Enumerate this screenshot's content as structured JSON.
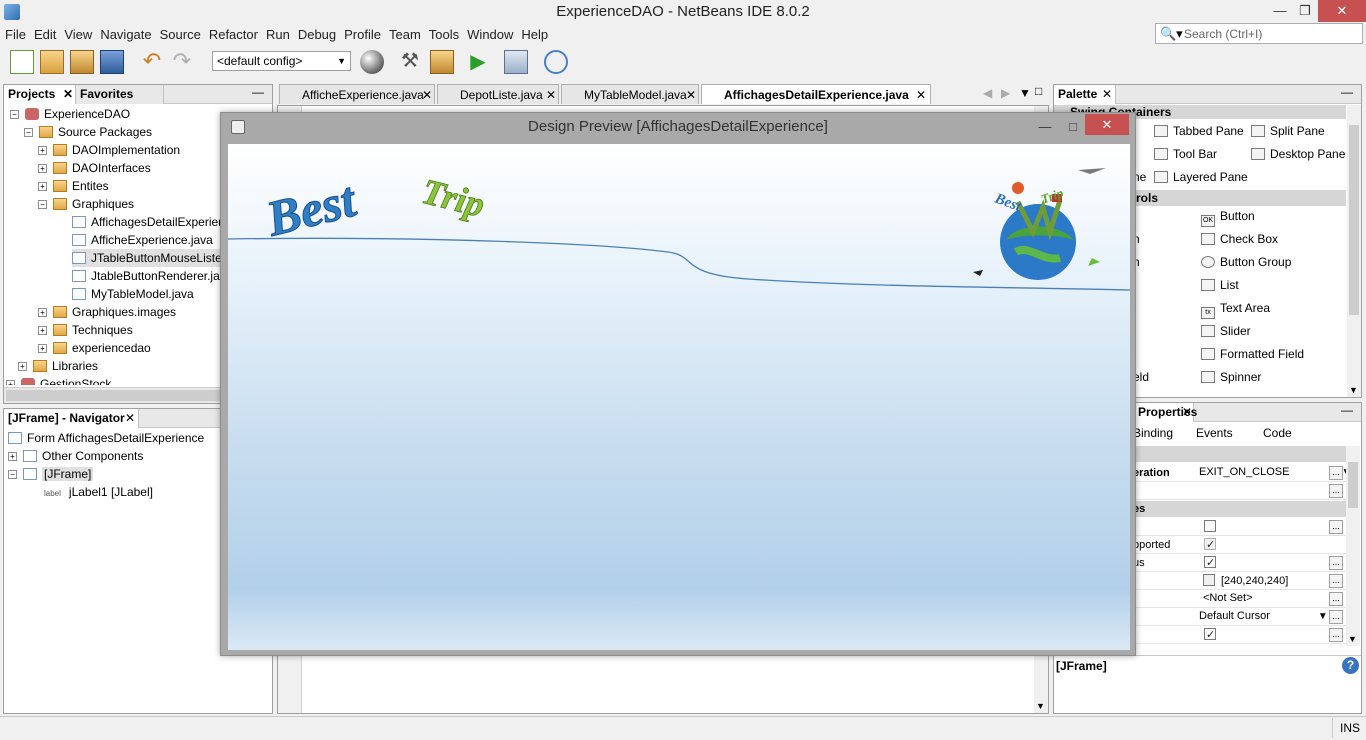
{
  "window": {
    "title": "ExperienceDAO - NetBeans IDE 8.0.2"
  },
  "menu": [
    "File",
    "Edit",
    "View",
    "Navigate",
    "Source",
    "Refactor",
    "Run",
    "Debug",
    "Profile",
    "Team",
    "Tools",
    "Window",
    "Help"
  ],
  "search": {
    "placeholder": "Search (Ctrl+I)"
  },
  "toolbar": {
    "config": "<default config>"
  },
  "projects_panel": {
    "tabs": [
      "Projects",
      "Favorites"
    ],
    "tree": [
      {
        "label": "ExperienceDAO",
        "icon": "project-icon"
      },
      {
        "label": "Source Packages",
        "icon": "folder-icon"
      },
      {
        "label": "DAOImplementation",
        "icon": "package-icon"
      },
      {
        "label": "DAOInterfaces",
        "icon": "package-icon"
      },
      {
        "label": "Entites",
        "icon": "package-icon"
      },
      {
        "label": "Graphiques",
        "icon": "package-icon"
      },
      {
        "label": "AffichagesDetailExperien",
        "icon": "java-file-icon"
      },
      {
        "label": "AfficheExperience.java",
        "icon": "java-file-icon"
      },
      {
        "label": "JTableButtonMouseListene",
        "icon": "java-file-icon"
      },
      {
        "label": "JtableButtonRenderer.jav",
        "icon": "java-file-icon"
      },
      {
        "label": "MyTableModel.java",
        "icon": "java-file-icon"
      },
      {
        "label": "Graphiques.images",
        "icon": "package-icon"
      },
      {
        "label": "Techniques",
        "icon": "package-icon"
      },
      {
        "label": "experiencedao",
        "icon": "package-icon"
      },
      {
        "label": "Libraries",
        "icon": "library-icon"
      },
      {
        "label": "GestionStock",
        "icon": "project-icon"
      }
    ]
  },
  "navigator": {
    "tab": "[JFrame] - Navigator",
    "items": [
      "Form AffichagesDetailExperience",
      "Other Components",
      "[JFrame]",
      "jLabel1 [JLabel]"
    ],
    "label_icon_text": "label"
  },
  "editor_tabs": [
    "AfficheExperience.java",
    "DepotListe.java",
    "MyTableModel.java",
    "AffichagesDetailExperience.java"
  ],
  "preview": {
    "title": "Design Preview [AffichagesDetailExperience]",
    "logo_word1": "Best",
    "logo_word2": "Trip"
  },
  "palette": {
    "tab": "Palette",
    "section1": "Swing Containers",
    "section2": "Swing Controls",
    "containers": [
      "Tabbed Pane",
      "Split Pane",
      "Tool Bar",
      "Desktop Pane",
      "Layered Pane"
    ],
    "left_fragments": [
      "ne",
      "n",
      "n",
      "eld"
    ],
    "controls": [
      "Button",
      "Check Box",
      "Button Group",
      "List",
      "Text Area",
      "Slider",
      "Formatted Field",
      "Spinner"
    ],
    "control_icon_text": [
      "OK",
      "",
      "",
      "",
      "tx",
      "",
      "",
      ""
    ]
  },
  "properties": {
    "tab": "Properties",
    "subtabs": [
      "Binding",
      "Events",
      "Code"
    ],
    "rows": [
      {
        "label": "eration",
        "value": "EXIT_ON_CLOSE"
      },
      {
        "label": "es",
        "value": ""
      },
      {
        "label": "pported",
        "value": ""
      },
      {
        "label": "us",
        "value": ""
      },
      {
        "label": "",
        "value": "[240,240,240]"
      },
      {
        "label": "",
        "value": "<Not Set>"
      },
      {
        "label": "",
        "value": "Default Cursor"
      }
    ],
    "footer": "[JFrame]"
  },
  "status": {
    "mode": "INS"
  }
}
